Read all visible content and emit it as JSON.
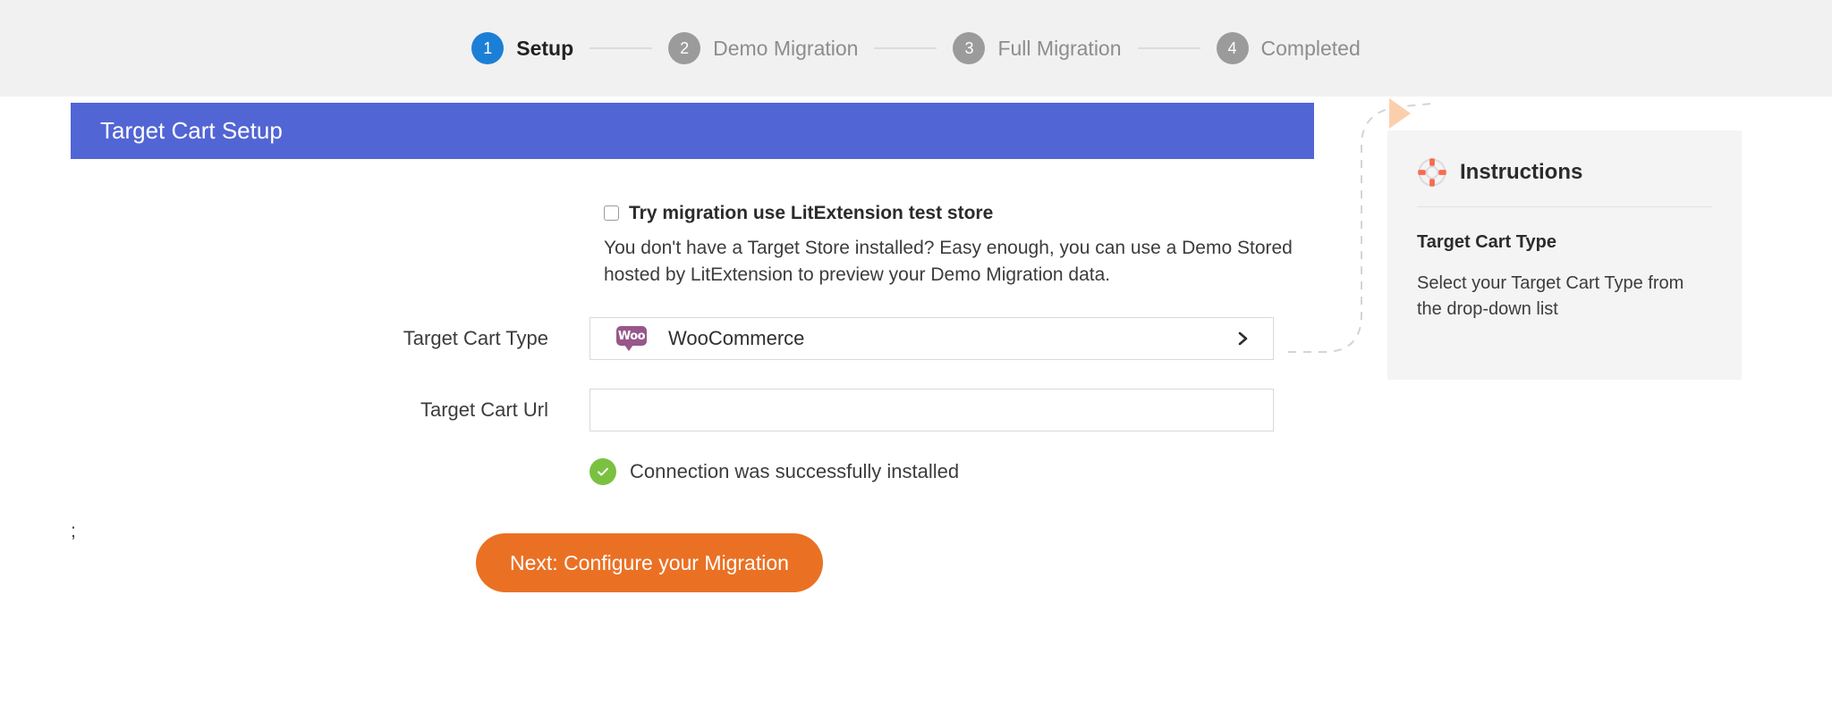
{
  "stepper": {
    "steps": [
      {
        "number": "1",
        "label": "Setup",
        "state": "active"
      },
      {
        "number": "2",
        "label": "Demo Migration",
        "state": "inactive"
      },
      {
        "number": "3",
        "label": "Full Migration",
        "state": "inactive"
      },
      {
        "number": "4",
        "label": "Completed",
        "state": "inactive"
      }
    ],
    "active_color": "#1c7fd6",
    "inactive_color": "#9b9b9b",
    "band_color": "#f1f1f1"
  },
  "card": {
    "header_title": "Target Cart Setup",
    "header_color": "#5265d4",
    "demo": {
      "checkbox_label": "Try migration use LitExtension test store",
      "checked": false,
      "description": "You don't have a Target Store installed? Easy enough, you can use a Demo Stored hosted by LitExtension to preview your Demo Migration data."
    },
    "cart_type": {
      "label": "Target Cart Type",
      "value": "WooCommerce",
      "logo_text": "Woo",
      "logo_color": "#96588a",
      "chevron": "chevron-right-icon"
    },
    "cart_url": {
      "label": "Target Cart Url",
      "value": "",
      "placeholder": ""
    },
    "status": {
      "text": "Connection was successfully installed",
      "icon": "check-circle-icon",
      "color": "#7ac142"
    },
    "stray_text": ";",
    "next_button": {
      "label": "Next: Configure your Migration",
      "color": "#ea7124"
    }
  },
  "instructions": {
    "icon": "lifebuoy-icon",
    "icon_color": "#f96b51",
    "title": "Instructions",
    "subtitle": "Target Cart Type",
    "body": "Select your Target Cart Type from the drop-down list",
    "panel_color": "#f4f4f4",
    "arrow_color": "#fbcfae"
  }
}
